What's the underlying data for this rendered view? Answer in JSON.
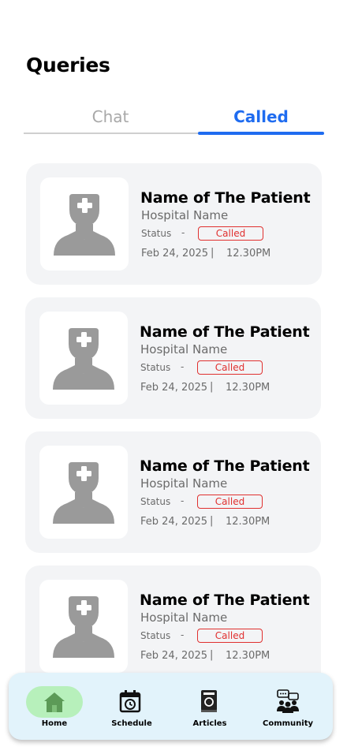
{
  "page": {
    "title": "Queries"
  },
  "tabs": [
    {
      "label": "Chat",
      "active": false
    },
    {
      "label": "Called",
      "active": true
    }
  ],
  "colors": {
    "accent": "#1f6cf0",
    "status_called": "#e0302f",
    "card_bg": "#f3f4f6",
    "nav_bg": "#e2f3fb",
    "home_pill": "#b7f0bb"
  },
  "queries": [
    {
      "patient_name": "Name of The Patient",
      "hospital": "Hospital Name",
      "status_label": "Status",
      "status_dash": "-",
      "status": "Called",
      "date": "Feb 24, 2025",
      "separator": "|",
      "time": "12.30PM",
      "avatar_icon": "doctor-avatar-icon"
    },
    {
      "patient_name": "Name of The Patient",
      "hospital": "Hospital Name",
      "status_label": "Status",
      "status_dash": "-",
      "status": "Called",
      "date": "Feb 24, 2025",
      "separator": "|",
      "time": "12.30PM",
      "avatar_icon": "doctor-avatar-icon"
    },
    {
      "patient_name": "Name of The Patient",
      "hospital": "Hospital Name",
      "status_label": "Status",
      "status_dash": "-",
      "status": "Called",
      "date": "Feb 24, 2025",
      "separator": "|",
      "time": "12.30PM",
      "avatar_icon": "doctor-avatar-icon"
    },
    {
      "patient_name": "Name of The Patient",
      "hospital": "Hospital Name",
      "status_label": "Status",
      "status_dash": "-",
      "status": "Called",
      "date": "Feb 24, 2025",
      "separator": "|",
      "time": "12.30PM",
      "avatar_icon": "doctor-avatar-icon"
    }
  ],
  "nav": {
    "items": [
      {
        "label": "Home",
        "icon": "home-icon",
        "active": true
      },
      {
        "label": "Schedule",
        "icon": "calendar-clock-icon",
        "active": false
      },
      {
        "label": "Articles",
        "icon": "book-icon",
        "active": false
      },
      {
        "label": "Community",
        "icon": "community-chat-icon",
        "active": false
      }
    ]
  }
}
